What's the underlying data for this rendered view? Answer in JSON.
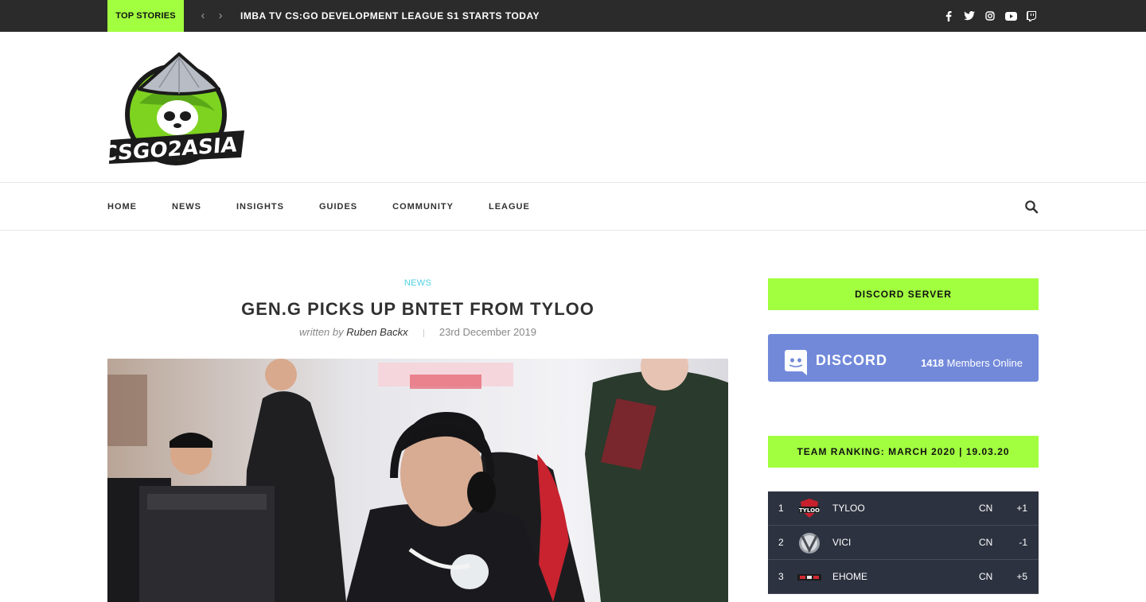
{
  "topbar": {
    "label": "TOP STORIES",
    "prev_icon": "chevron-left-icon",
    "next_icon": "chevron-right-icon",
    "headline": "IMBA TV CS:GO DEVELOPMENT LEAGUE S1 STARTS TODAY",
    "socials": [
      "facebook-icon",
      "twitter-icon",
      "instagram-icon",
      "youtube-icon",
      "twitch-icon"
    ]
  },
  "header": {
    "logo_text": "CSGO2ASIA"
  },
  "nav": {
    "items": [
      "HOME",
      "NEWS",
      "INSIGHTS",
      "GUIDES",
      "COMMUNITY",
      "LEAGUE"
    ],
    "search_icon": "search-icon"
  },
  "article": {
    "category": "NEWS",
    "title": "GEN.G PICKS UP BNTET FROM TYLOO",
    "written_by": "written by",
    "author": "Ruben Backx",
    "date": "23rd December 2019"
  },
  "sidebar": {
    "discord_heading": "DISCORD SERVER",
    "discord_word": "DISCORD",
    "discord_count": "1418",
    "discord_online_label": "Members Online",
    "ranking_heading": "TEAM RANKING: MARCH 2020 | 19.03.20",
    "ranking": [
      {
        "pos": "1",
        "team": "TYLOO",
        "country": "CN",
        "change": "+1"
      },
      {
        "pos": "2",
        "team": "VICI",
        "country": "CN",
        "change": "-1"
      },
      {
        "pos": "3",
        "team": "EHOME",
        "country": "CN",
        "change": "+5"
      }
    ]
  },
  "colors": {
    "accent": "#a2ff3f",
    "topbar_bg": "#2b2b2b",
    "category": "#4ed0e0",
    "discord": "#7289da",
    "ranking_bg": "#2d3240"
  }
}
